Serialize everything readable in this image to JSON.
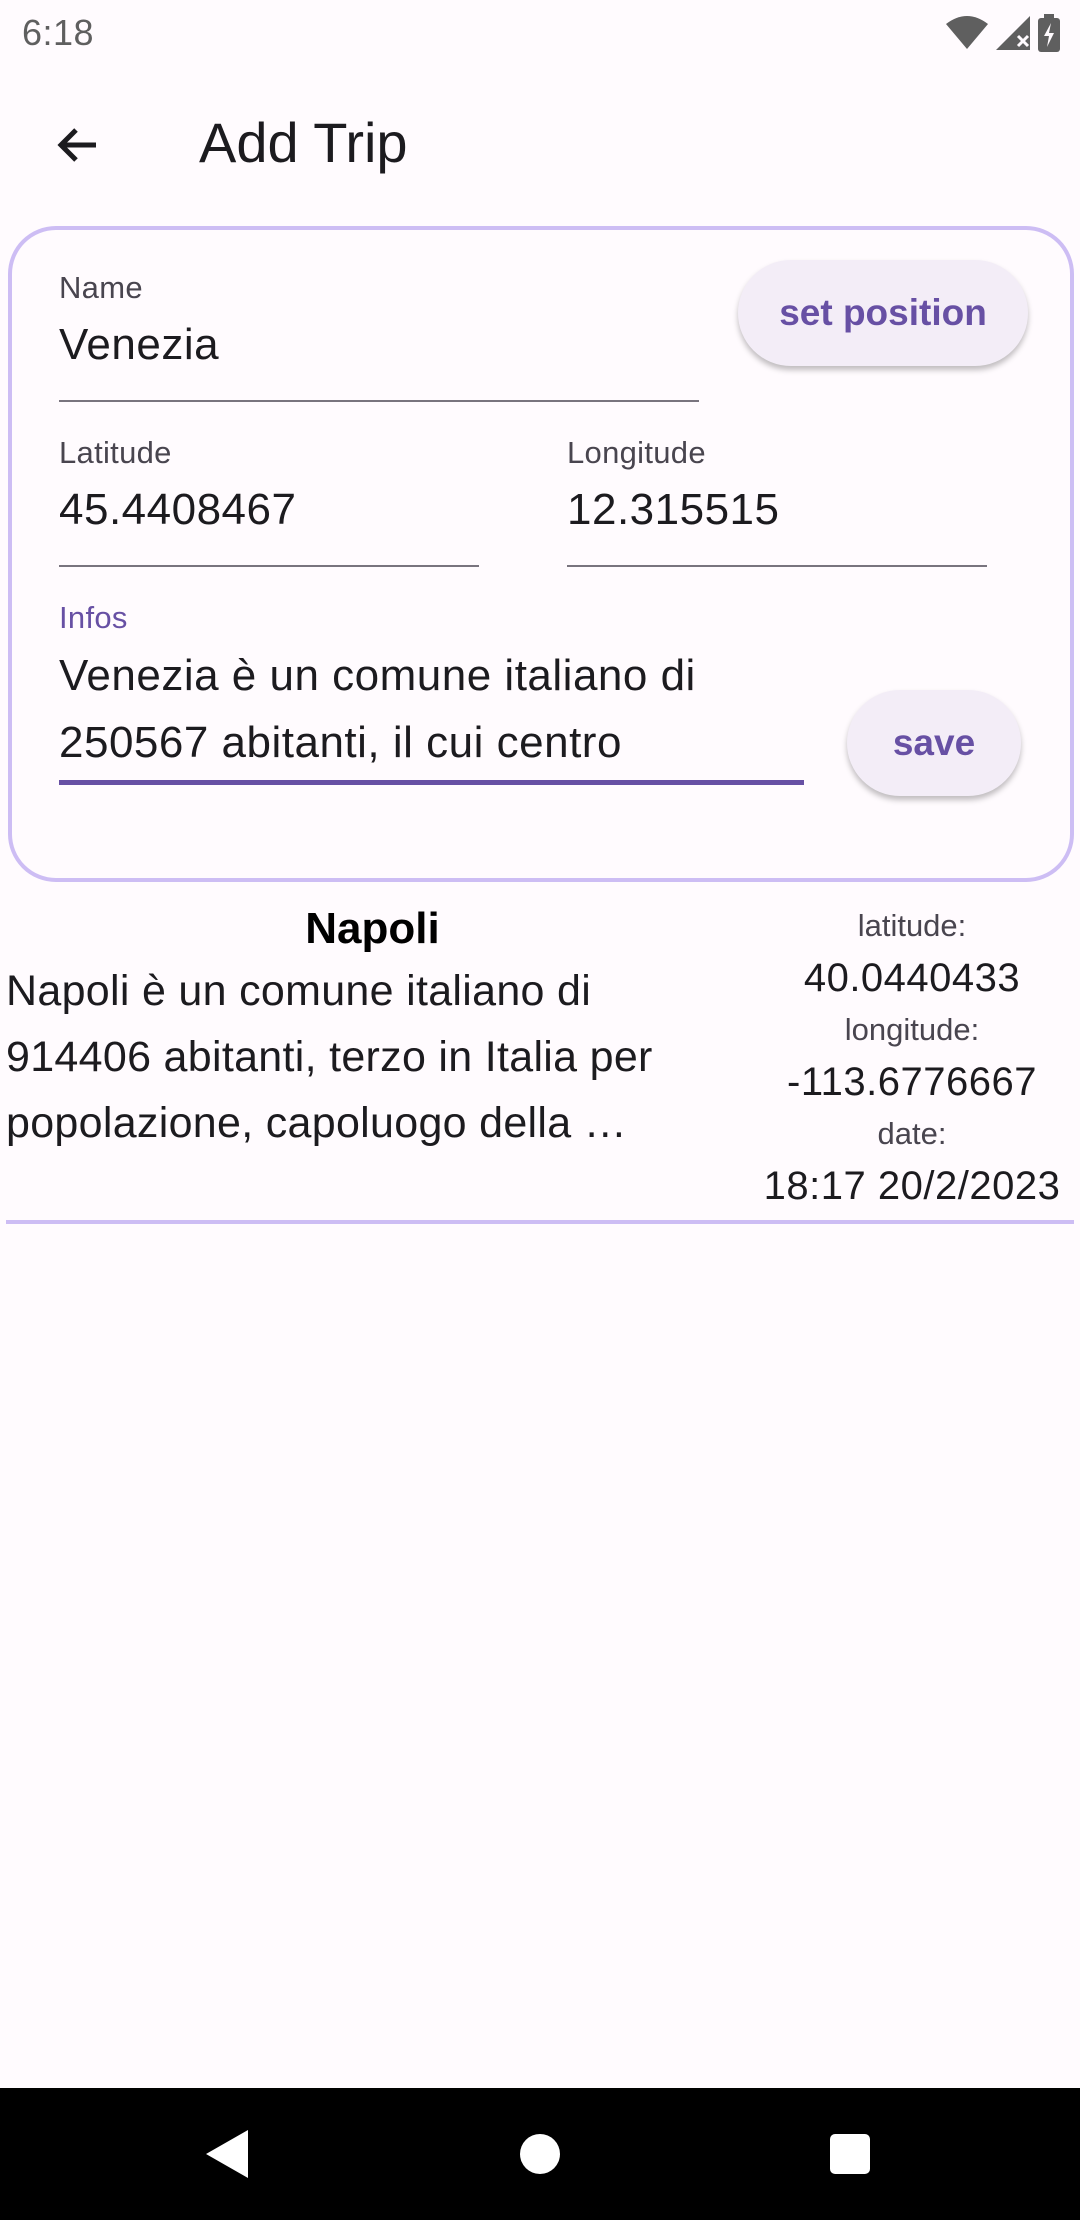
{
  "status_bar": {
    "time": "6:18",
    "icons": [
      "wifi-icon",
      "signal-icon",
      "battery-charging-icon"
    ]
  },
  "app_bar": {
    "back_icon": "arrow-back-icon",
    "title": "Add Trip"
  },
  "form": {
    "name": {
      "label": "Name",
      "value": "Venezia"
    },
    "set_position_label": "set position",
    "latitude": {
      "label": "Latitude",
      "value": "45.4408467"
    },
    "longitude": {
      "label": "Longitude",
      "value": "12.315515"
    },
    "infos": {
      "label": "Infos",
      "line1": "Venezia è un comune italiano di",
      "line2": "250567 abitanti, il cui centro"
    },
    "save_label": "save"
  },
  "trips": [
    {
      "name": "Napoli",
      "desc_line1": "Napoli è un comune italiano di",
      "desc_line2": "914406 abitanti, terzo in Italia per",
      "desc_line3": "popolazione, capoluogo della …",
      "latitude_label": "latitude:",
      "latitude": "40.0440433",
      "longitude_label": "longitude:",
      "longitude": "-113.6776667",
      "date_label": "date:",
      "date": "18:17 20/2/2023"
    }
  ],
  "colors": {
    "primary": "#6750a4",
    "outline_accent": "#cdbdf4",
    "background": "#fffbfe",
    "button_bg": "#f3edf7"
  }
}
